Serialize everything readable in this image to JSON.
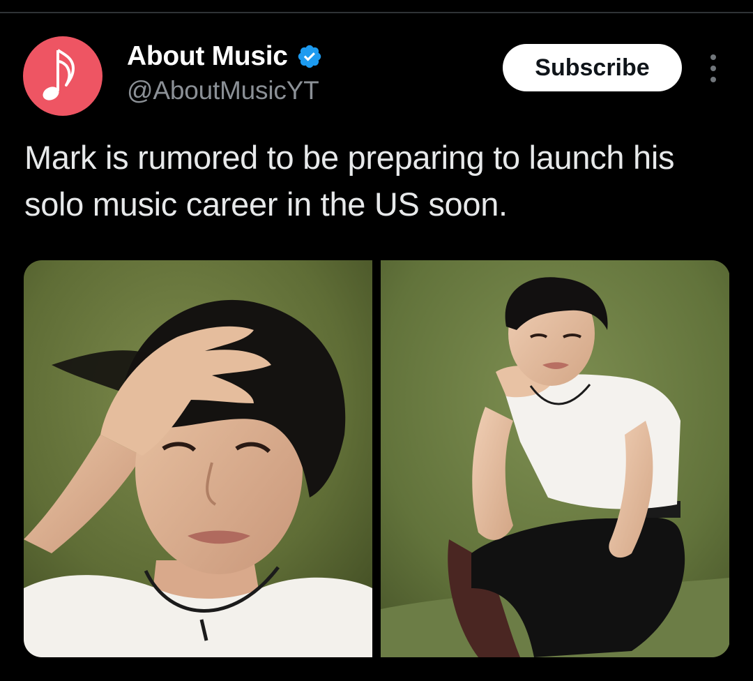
{
  "account": {
    "display_name": "About Music",
    "handle": "@AboutMusicYT",
    "verified": true,
    "avatar_icon": "music-note-icon",
    "avatar_color": "#ee5563",
    "verified_color": "#1d9bf0"
  },
  "actions": {
    "subscribe_label": "Subscribe",
    "more_icon": "more-vertical-icon"
  },
  "post": {
    "text": "Mark is rumored to be preparing to launch his solo music career in the US soon."
  },
  "media": {
    "photos": [
      {
        "name": "photo-left",
        "subject": "portrait-hand-in-hair"
      },
      {
        "name": "photo-right",
        "subject": "crouching-pose-on-chair"
      }
    ]
  },
  "theme": {
    "background": "#000000",
    "text_primary": "#e7e9ea",
    "text_secondary": "#8b9096"
  }
}
